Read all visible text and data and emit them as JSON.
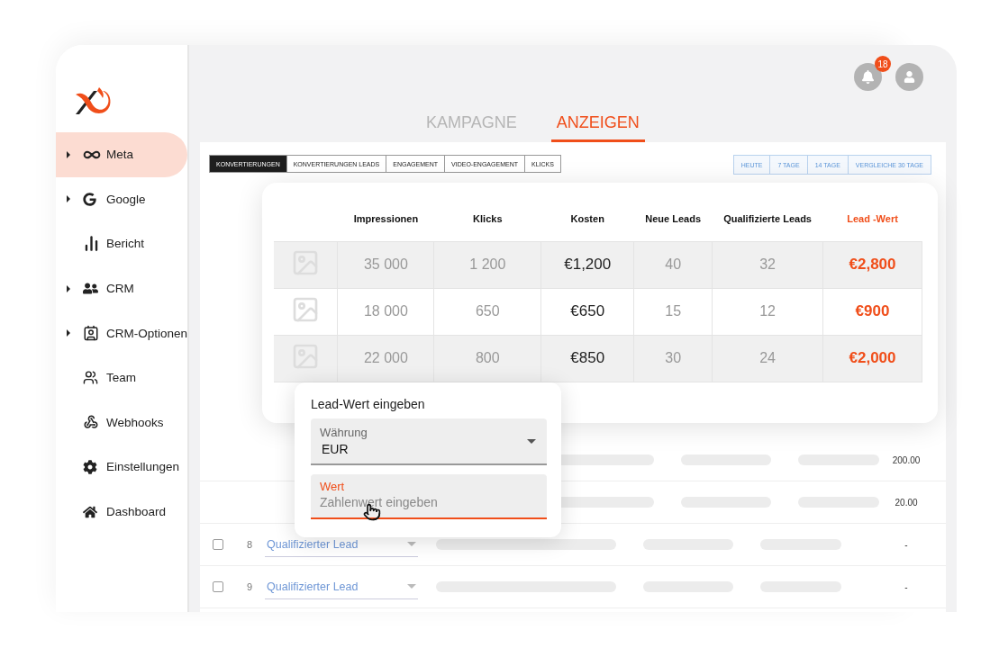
{
  "sidebar": {
    "items": [
      {
        "label": "Meta",
        "expandable": true,
        "selected": true
      },
      {
        "label": "Google",
        "expandable": true,
        "selected": false
      },
      {
        "label": "Bericht",
        "expandable": false,
        "selected": false
      },
      {
        "label": "CRM",
        "expandable": true,
        "selected": false
      },
      {
        "label": "CRM-Optionen",
        "expandable": true,
        "selected": false
      },
      {
        "label": "Team",
        "expandable": false,
        "selected": false
      },
      {
        "label": "Webhooks",
        "expandable": false,
        "selected": false
      },
      {
        "label": "Einstellungen",
        "expandable": false,
        "selected": false
      },
      {
        "label": "Dashboard",
        "expandable": false,
        "selected": false
      }
    ]
  },
  "header": {
    "notification_count": "18"
  },
  "tabs": [
    {
      "label": "KAMPAGNE",
      "selected": false
    },
    {
      "label": "ANZEIGEN",
      "selected": true
    }
  ],
  "metric_tabs": [
    {
      "label": "KONVERTIERUNGEN",
      "selected": true
    },
    {
      "label": "KONVERTIERUNGEN LEADS",
      "selected": false
    },
    {
      "label": "ENGAGEMENT",
      "selected": false
    },
    {
      "label": "VIDEO-ENGAGEMENT",
      "selected": false
    },
    {
      "label": "KLICKS",
      "selected": false
    }
  ],
  "date_ranges": [
    {
      "label": "HEUTE"
    },
    {
      "label": "7 TAGE"
    },
    {
      "label": "14 TAGE"
    },
    {
      "label": "VERGLEICHE 30 TAGE"
    }
  ],
  "ads_table": {
    "columns": [
      {
        "label": "Impressionen",
        "kind": "count"
      },
      {
        "label": "Klicks",
        "kind": "count"
      },
      {
        "label": "Kosten",
        "kind": "cost"
      },
      {
        "label": "Neue Leads",
        "kind": "count"
      },
      {
        "label": "Qualifizierte Leads",
        "kind": "count"
      },
      {
        "label": "Lead -Wert",
        "kind": "lead_value"
      }
    ],
    "rows": [
      {
        "cells": [
          "35 000",
          "1 200",
          "€1,200",
          "40",
          "32",
          "€2,800"
        ]
      },
      {
        "cells": [
          "18 000",
          "650",
          "€650",
          "15",
          "12",
          "€900"
        ]
      },
      {
        "cells": [
          "22 000",
          "800",
          "€850",
          "30",
          "24",
          "€2,000"
        ]
      }
    ]
  },
  "lead_value_popup": {
    "title": "Lead-Wert eingeben",
    "currency": {
      "label": "Währung",
      "value": "EUR"
    },
    "value_field": {
      "label": "Wert",
      "placeholder": "Zahlenwert eingeben",
      "focused": true
    }
  },
  "background_rows": [
    {
      "amount": "200.00"
    },
    {
      "amount": "20.00"
    },
    {
      "number": "8",
      "checked": false,
      "status": "Qualifizierter Lead",
      "amount": "-"
    },
    {
      "number": "9",
      "checked": false,
      "status": "Qualifizierter Lead",
      "amount": "-"
    }
  ]
}
